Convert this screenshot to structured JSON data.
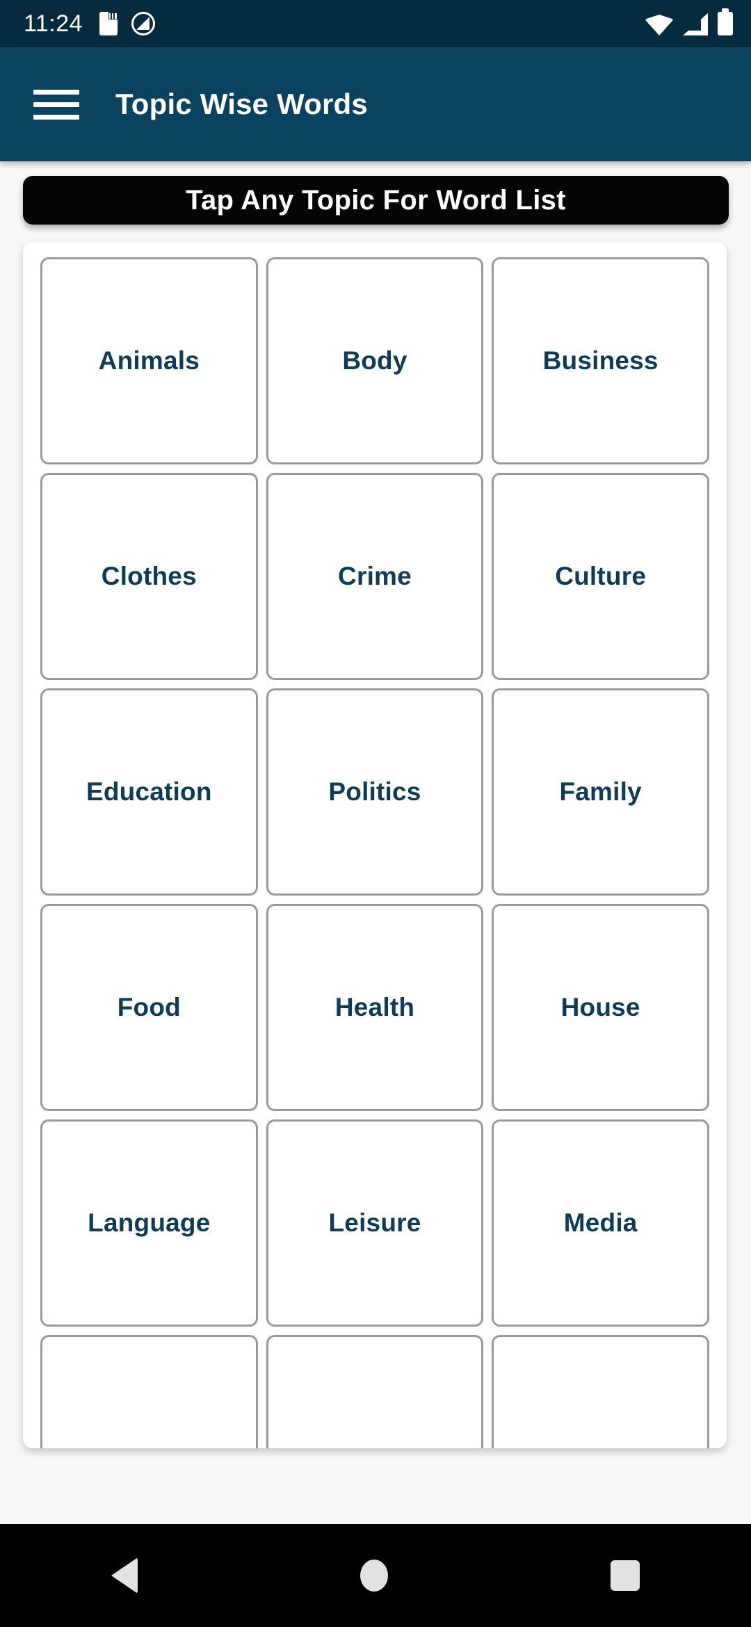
{
  "status_bar": {
    "time": "11:24",
    "left_icons": [
      "sdcard-icon",
      "data-saver-icon"
    ],
    "right_icons": [
      "wifi-icon",
      "signal-icon",
      "battery-icon"
    ],
    "background_color": "#042b3e"
  },
  "app_bar": {
    "menu_icon": "hamburger-menu-icon",
    "title": "Topic Wise Words",
    "background_color": "#0a4260",
    "text_color": "#ffffff"
  },
  "banner": {
    "text": "Tap Any Topic For Word List",
    "background_color": "#050505",
    "text_color": "#ffffff"
  },
  "topics": {
    "card_text_color": "#0e3c56",
    "card_border_color": "#9a9a9a",
    "items": [
      {
        "label": "Animals"
      },
      {
        "label": "Body"
      },
      {
        "label": "Business"
      },
      {
        "label": "Clothes"
      },
      {
        "label": "Crime"
      },
      {
        "label": "Culture"
      },
      {
        "label": "Education"
      },
      {
        "label": "Politics"
      },
      {
        "label": "Family"
      },
      {
        "label": "Food"
      },
      {
        "label": "Health"
      },
      {
        "label": "House"
      },
      {
        "label": "Language"
      },
      {
        "label": "Leisure"
      },
      {
        "label": "Media"
      },
      {
        "label": ""
      },
      {
        "label": ""
      },
      {
        "label": ""
      }
    ]
  },
  "nav_bar": {
    "background_color": "#000000",
    "buttons": [
      "back-icon",
      "home-icon",
      "recents-icon"
    ]
  }
}
